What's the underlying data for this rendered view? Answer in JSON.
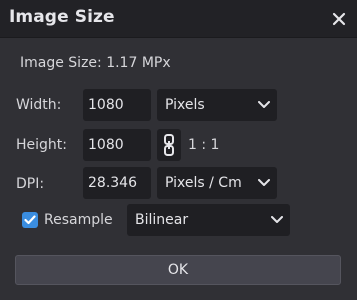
{
  "window": {
    "title": "Image Size",
    "close_icon": "close-icon"
  },
  "info": {
    "image_size": "Image Size: 1.17 MPx"
  },
  "width": {
    "label": "Width:",
    "value": "1080",
    "unit": "Pixels"
  },
  "height": {
    "label": "Height:",
    "value": "1080",
    "link_icon": "chain-link-icon",
    "ratio": "1 : 1"
  },
  "dpi": {
    "label": "DPI:",
    "value": "28.346",
    "unit": "Pixels / Cm"
  },
  "resample": {
    "checked": true,
    "label": "Resample",
    "method": "Bilinear"
  },
  "buttons": {
    "ok": "OK"
  },
  "colors": {
    "accent": "#3a8de0",
    "background": "#303035",
    "titlebar": "#222226",
    "field": "#1f1f23"
  }
}
